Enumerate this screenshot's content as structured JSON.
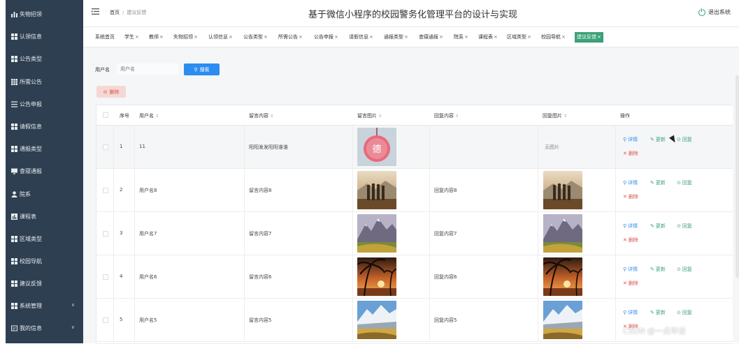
{
  "app": {
    "title": "基于微信小程序的校园警务化管理平台的设计与实现",
    "logout_label": "退出系统"
  },
  "breadcrumb": {
    "home": "首页",
    "current": "建议反馈"
  },
  "sidebar": {
    "items": [
      {
        "label": "失物招领",
        "icon": "bar-chart-icon"
      },
      {
        "label": "认领信息",
        "icon": "grid-icon"
      },
      {
        "label": "公告类型",
        "icon": "grid-icon"
      },
      {
        "label": "所需公告",
        "icon": "table-icon"
      },
      {
        "label": "公告申报",
        "icon": "list-icon"
      },
      {
        "label": "请假信息",
        "icon": "grid-icon"
      },
      {
        "label": "通报类型",
        "icon": "grid-icon"
      },
      {
        "label": "查寝通报",
        "icon": "monitor-icon"
      },
      {
        "label": "院系",
        "icon": "user-icon"
      },
      {
        "label": "课程表",
        "icon": "chart-icon"
      },
      {
        "label": "区域类型",
        "icon": "grid-icon"
      },
      {
        "label": "校园导航",
        "icon": "grid-icon"
      },
      {
        "label": "建议反馈",
        "icon": "grid-icon"
      },
      {
        "label": "系统管理",
        "icon": "grid-icon",
        "chevron": true
      },
      {
        "label": "我的信息",
        "icon": "card-icon",
        "chevron": true
      }
    ]
  },
  "tabs": [
    {
      "label": "系统首页",
      "closable": false
    },
    {
      "label": "学生",
      "closable": true
    },
    {
      "label": "教师",
      "closable": true
    },
    {
      "label": "失物招领",
      "closable": true
    },
    {
      "label": "认领信息",
      "closable": true
    },
    {
      "label": "公告类型",
      "closable": true
    },
    {
      "label": "所需公告",
      "closable": true
    },
    {
      "label": "公告申报",
      "closable": true
    },
    {
      "label": "请假信息",
      "closable": true
    },
    {
      "label": "通报类型",
      "closable": true
    },
    {
      "label": "查寝通报",
      "closable": true
    },
    {
      "label": "院系",
      "closable": true
    },
    {
      "label": "课程表",
      "closable": true
    },
    {
      "label": "区域类型",
      "closable": true
    },
    {
      "label": "校园导航",
      "closable": true
    },
    {
      "label": "建议反馈",
      "closable": true,
      "active": true
    }
  ],
  "search": {
    "label": "用户名",
    "placeholder": "用户名",
    "button_label": "搜索"
  },
  "delete_button_label": "删除",
  "table": {
    "headers": {
      "index": "序号",
      "username": "用户名",
      "message": "留言内容",
      "message_image": "留言图片",
      "reply": "回复内容",
      "reply_image": "回复图片",
      "actions": "操作"
    },
    "actions": {
      "detail": "详情",
      "update": "更新",
      "reply": "回复",
      "delete": "删除"
    },
    "rows": [
      {
        "index": "1",
        "username": "11",
        "message": "阳阳发发阳阳谁谁",
        "reply": "",
        "reply_image_text": "无图片",
        "image": "pink-tag",
        "reply_img": ""
      },
      {
        "index": "2",
        "username": "用户名8",
        "message": "留言内容8",
        "reply": "回复内容8",
        "reply_image_text": "",
        "image": "group",
        "reply_img": "group"
      },
      {
        "index": "3",
        "username": "用户名7",
        "message": "留言内容7",
        "reply": "回复内容7",
        "reply_image_text": "",
        "image": "mountain",
        "reply_img": "mountain"
      },
      {
        "index": "4",
        "username": "用户名6",
        "message": "留言内容6",
        "reply": "回复内容6",
        "reply_image_text": "",
        "image": "palm",
        "reply_img": "palm"
      },
      {
        "index": "5",
        "username": "用户名5",
        "message": "留言内容5",
        "reply": "回复内容5",
        "reply_image_text": "",
        "image": "snow",
        "reply_img": "snow"
      }
    ]
  },
  "watermark": "CSDN @一点毕设",
  "colors": {
    "sidebar": "#2e3f51",
    "accent": "#3ba178",
    "primary": "#2d8cf0",
    "danger": "#d9534f"
  }
}
